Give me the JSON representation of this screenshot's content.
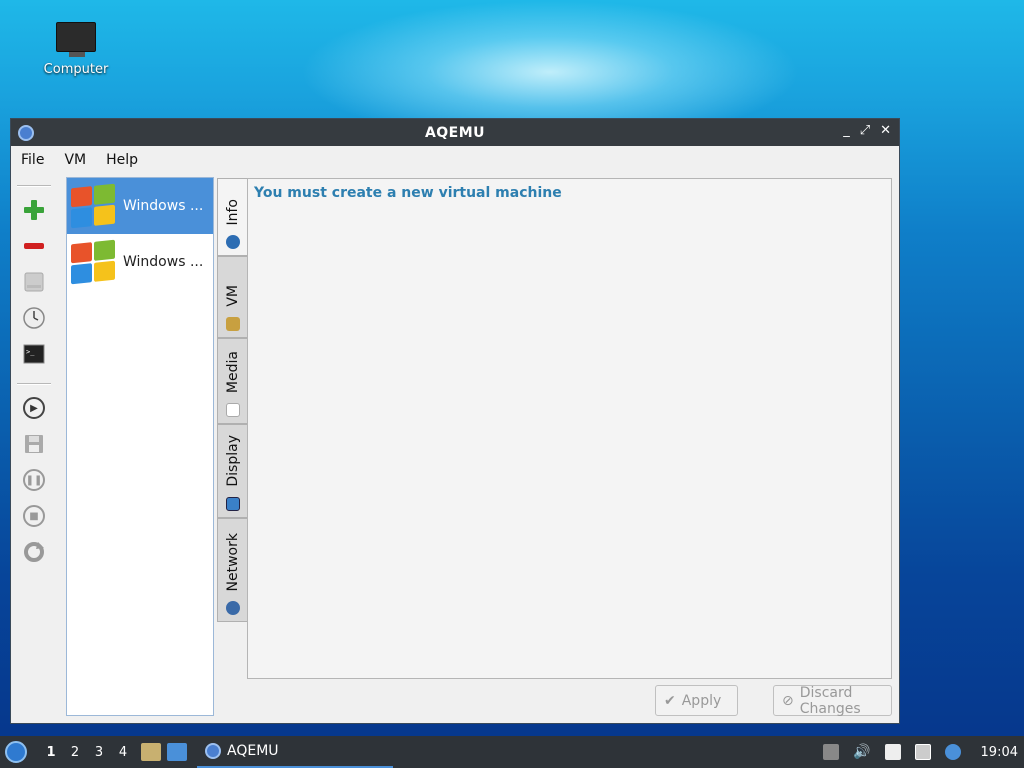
{
  "desktop": {
    "icon_label": "Computer"
  },
  "window": {
    "title": "AQEMU",
    "controls": [
      "_",
      "⤢",
      "✕"
    ]
  },
  "menu": [
    "File",
    "VM",
    "Help"
  ],
  "vm_list": [
    {
      "name": "Windows ...",
      "selected": true
    },
    {
      "name": "Windows ...",
      "selected": false
    }
  ],
  "tabs": [
    {
      "label": "Info",
      "icon": "info-icon"
    },
    {
      "label": "VM",
      "icon": "tools-icon"
    },
    {
      "label": "Media",
      "icon": "disk-icon"
    },
    {
      "label": "Display",
      "icon": "display-icon"
    },
    {
      "label": "Network",
      "icon": "network-icon"
    }
  ],
  "panel": {
    "message": "You must create a new virtual machine"
  },
  "buttons": {
    "apply": "Apply",
    "discard": "Discard Changes"
  },
  "taskbar": {
    "workspaces": [
      "1",
      "2",
      "3",
      "4"
    ],
    "active_app": "AQEMU",
    "clock": "19:04"
  },
  "colors": {
    "accent": "#4a90d9",
    "message": "#2d7fb0"
  }
}
